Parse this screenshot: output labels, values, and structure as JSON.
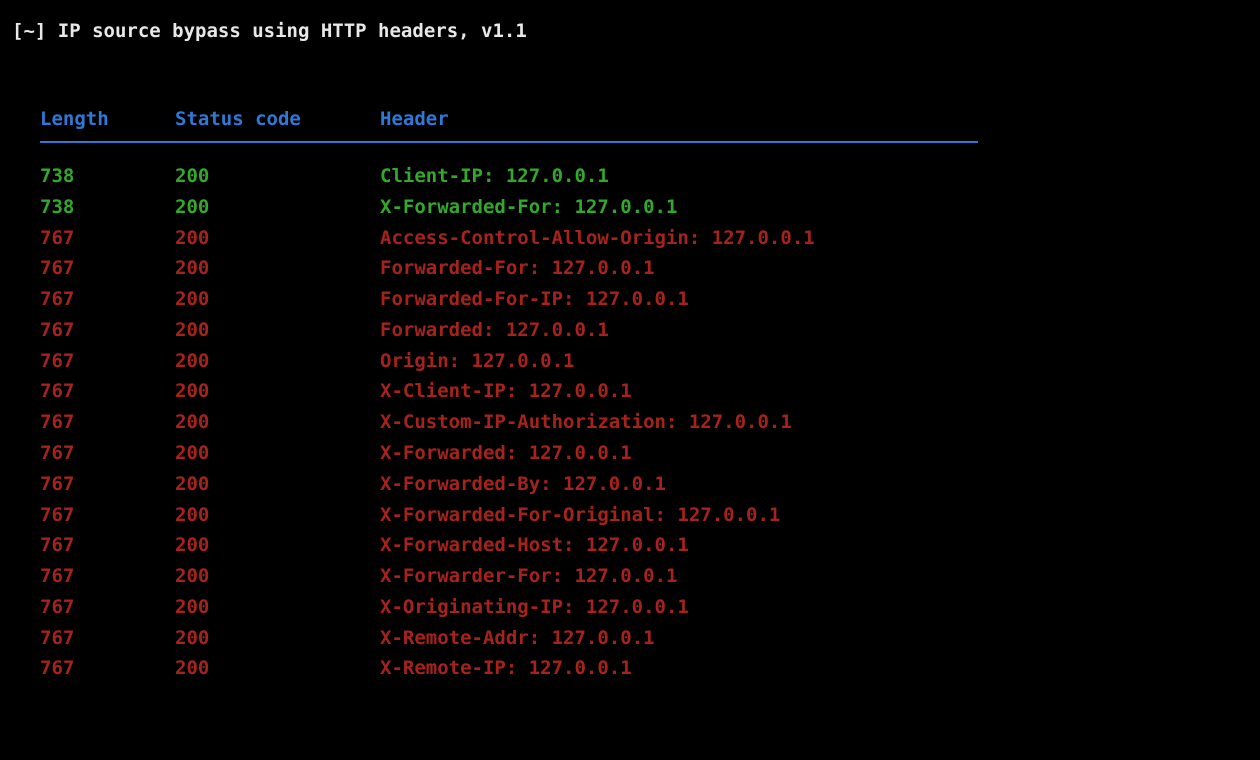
{
  "title": {
    "prefix": "[~] ",
    "text": "IP source bypass using HTTP headers, v1.1"
  },
  "columns": {
    "length": "Length",
    "status": "Status code",
    "header": "Header"
  },
  "rows": [
    {
      "length": "738",
      "status": "200",
      "header": "Client-IP: 127.0.0.1",
      "state": "green"
    },
    {
      "length": "738",
      "status": "200",
      "header": "X-Forwarded-For: 127.0.0.1",
      "state": "green"
    },
    {
      "length": "767",
      "status": "200",
      "header": "Access-Control-Allow-Origin: 127.0.0.1",
      "state": "red"
    },
    {
      "length": "767",
      "status": "200",
      "header": "Forwarded-For: 127.0.0.1",
      "state": "red"
    },
    {
      "length": "767",
      "status": "200",
      "header": "Forwarded-For-IP: 127.0.0.1",
      "state": "red"
    },
    {
      "length": "767",
      "status": "200",
      "header": "Forwarded: 127.0.0.1",
      "state": "red"
    },
    {
      "length": "767",
      "status": "200",
      "header": "Origin: 127.0.0.1",
      "state": "red"
    },
    {
      "length": "767",
      "status": "200",
      "header": "X-Client-IP: 127.0.0.1",
      "state": "red"
    },
    {
      "length": "767",
      "status": "200",
      "header": "X-Custom-IP-Authorization: 127.0.0.1",
      "state": "red"
    },
    {
      "length": "767",
      "status": "200",
      "header": "X-Forwarded: 127.0.0.1",
      "state": "red"
    },
    {
      "length": "767",
      "status": "200",
      "header": "X-Forwarded-By: 127.0.0.1",
      "state": "red"
    },
    {
      "length": "767",
      "status": "200",
      "header": "X-Forwarded-For-Original: 127.0.0.1",
      "state": "red"
    },
    {
      "length": "767",
      "status": "200",
      "header": "X-Forwarded-Host: 127.0.0.1",
      "state": "red"
    },
    {
      "length": "767",
      "status": "200",
      "header": "X-Forwarder-For: 127.0.0.1",
      "state": "red"
    },
    {
      "length": "767",
      "status": "200",
      "header": "X-Originating-IP: 127.0.0.1",
      "state": "red"
    },
    {
      "length": "767",
      "status": "200",
      "header": "X-Remote-Addr: 127.0.0.1",
      "state": "red"
    },
    {
      "length": "767",
      "status": "200",
      "header": "X-Remote-IP: 127.0.0.1",
      "state": "red"
    }
  ]
}
